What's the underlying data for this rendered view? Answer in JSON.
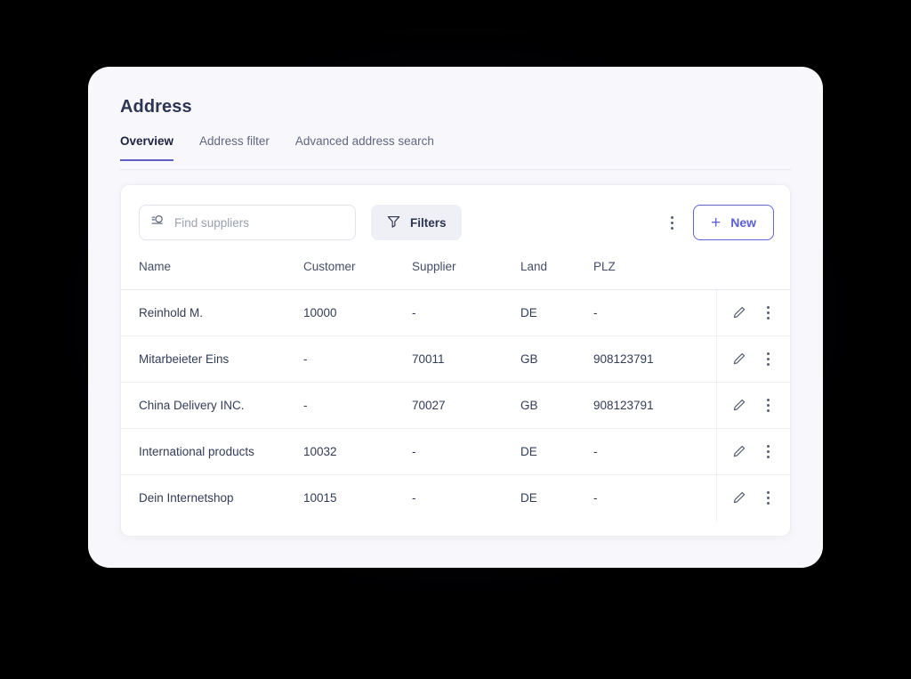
{
  "header": {
    "title": "Address"
  },
  "tabs": [
    {
      "label": "Overview",
      "active": true
    },
    {
      "label": "Address filter",
      "active": false
    },
    {
      "label": "Advanced address search",
      "active": false
    }
  ],
  "toolbar": {
    "search": {
      "placeholder": "Find suppliers",
      "value": "",
      "icon": "search-filter-icon"
    },
    "filters_label": "Filters",
    "filters_icon": "funnel-icon",
    "overflow_icon": "more-vertical-icon",
    "new_label": "New",
    "new_icon": "plus-icon"
  },
  "table": {
    "columns": [
      "Name",
      "Customer",
      "Supplier",
      "Land",
      "PLZ",
      ""
    ],
    "rows": [
      {
        "name": "Reinhold M.",
        "customer": "10000",
        "supplier": "-",
        "land": "DE",
        "plz": "-"
      },
      {
        "name": "Mitarbeieter Eins",
        "customer": "-",
        "supplier": "70011",
        "land": "GB",
        "plz": "908123791"
      },
      {
        "name": "China Delivery INC.",
        "customer": "-",
        "supplier": "70027",
        "land": "GB",
        "plz": "908123791"
      },
      {
        "name": "International products",
        "customer": "10032",
        "supplier": "-",
        "land": "DE",
        "plz": "-"
      },
      {
        "name": "Dein Internetshop",
        "customer": "10015",
        "supplier": "-",
        "land": "DE",
        "plz": "-"
      }
    ],
    "row_actions": {
      "edit_icon": "pencil-icon",
      "more_icon": "more-vertical-icon"
    }
  },
  "colors": {
    "accent": "#5b5fc7",
    "accent_border": "#6064d4",
    "title": "#2c3554",
    "surface": "#f8f8fc",
    "panel": "#ffffff",
    "backdrop": "#000000",
    "filters_bg": "#eef0f5"
  }
}
